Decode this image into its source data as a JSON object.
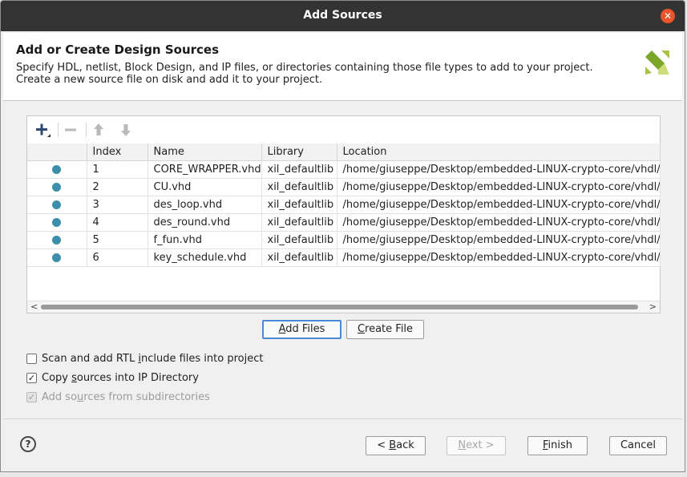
{
  "window": {
    "title": "Add Sources"
  },
  "header": {
    "heading": "Add or Create Design Sources",
    "description": "Specify HDL, netlist, Block Design, and IP files, or directories containing those file types to add to your project. Create a new source file on disk and add it to your project."
  },
  "table": {
    "columns": [
      "",
      "Index",
      "Name",
      "Library",
      "Location"
    ],
    "rows": [
      {
        "index": "1",
        "name": "CORE_WRAPPER.vhd",
        "library": "xil_defaultlib",
        "location": "/home/giuseppe/Desktop/embedded-LINUX-crypto-core/vhdl/src"
      },
      {
        "index": "2",
        "name": "CU.vhd",
        "library": "xil_defaultlib",
        "location": "/home/giuseppe/Desktop/embedded-LINUX-crypto-core/vhdl/src"
      },
      {
        "index": "3",
        "name": "des_loop.vhd",
        "library": "xil_defaultlib",
        "location": "/home/giuseppe/Desktop/embedded-LINUX-crypto-core/vhdl/src"
      },
      {
        "index": "4",
        "name": "des_round.vhd",
        "library": "xil_defaultlib",
        "location": "/home/giuseppe/Desktop/embedded-LINUX-crypto-core/vhdl/src"
      },
      {
        "index": "5",
        "name": "f_fun.vhd",
        "library": "xil_defaultlib",
        "location": "/home/giuseppe/Desktop/embedded-LINUX-crypto-core/vhdl/src"
      },
      {
        "index": "6",
        "name": "key_schedule.vhd",
        "library": "xil_defaultlib",
        "location": "/home/giuseppe/Desktop/embedded-LINUX-crypto-core/vhdl/src"
      }
    ]
  },
  "buttons": {
    "add_files": {
      "pre": "",
      "key": "A",
      "post": "dd Files"
    },
    "create_file": {
      "pre": "",
      "key": "C",
      "post": "reate File"
    },
    "back": {
      "pre": "< ",
      "key": "B",
      "post": "ack"
    },
    "next": {
      "pre": "",
      "key": "N",
      "post": "ext >"
    },
    "finish": {
      "pre": "",
      "key": "F",
      "post": "inish"
    },
    "cancel": "Cancel"
  },
  "options": {
    "scan_rtl": {
      "pre": "Scan and add RTL ",
      "key": "i",
      "post": "nclude files into project",
      "checked": false
    },
    "copy_sources": {
      "pre": "Copy ",
      "key": "s",
      "post": "ources into IP Directory",
      "checked": true
    },
    "add_subdirs": {
      "pre": "Add so",
      "key": "u",
      "post": "rces from subdirectories",
      "checked": true,
      "disabled": true
    }
  },
  "help_glyph": "?",
  "colors": {
    "titlebar": "#333333",
    "close": "#e9542a",
    "status_dot": "#3b8fab",
    "focus": "#4a8ad4",
    "logo_green": "#7aa62a"
  },
  "icons": [
    "close-icon",
    "add-icon",
    "remove-icon",
    "move-up-icon",
    "move-down-icon",
    "help-icon",
    "xilinx-logo"
  ]
}
